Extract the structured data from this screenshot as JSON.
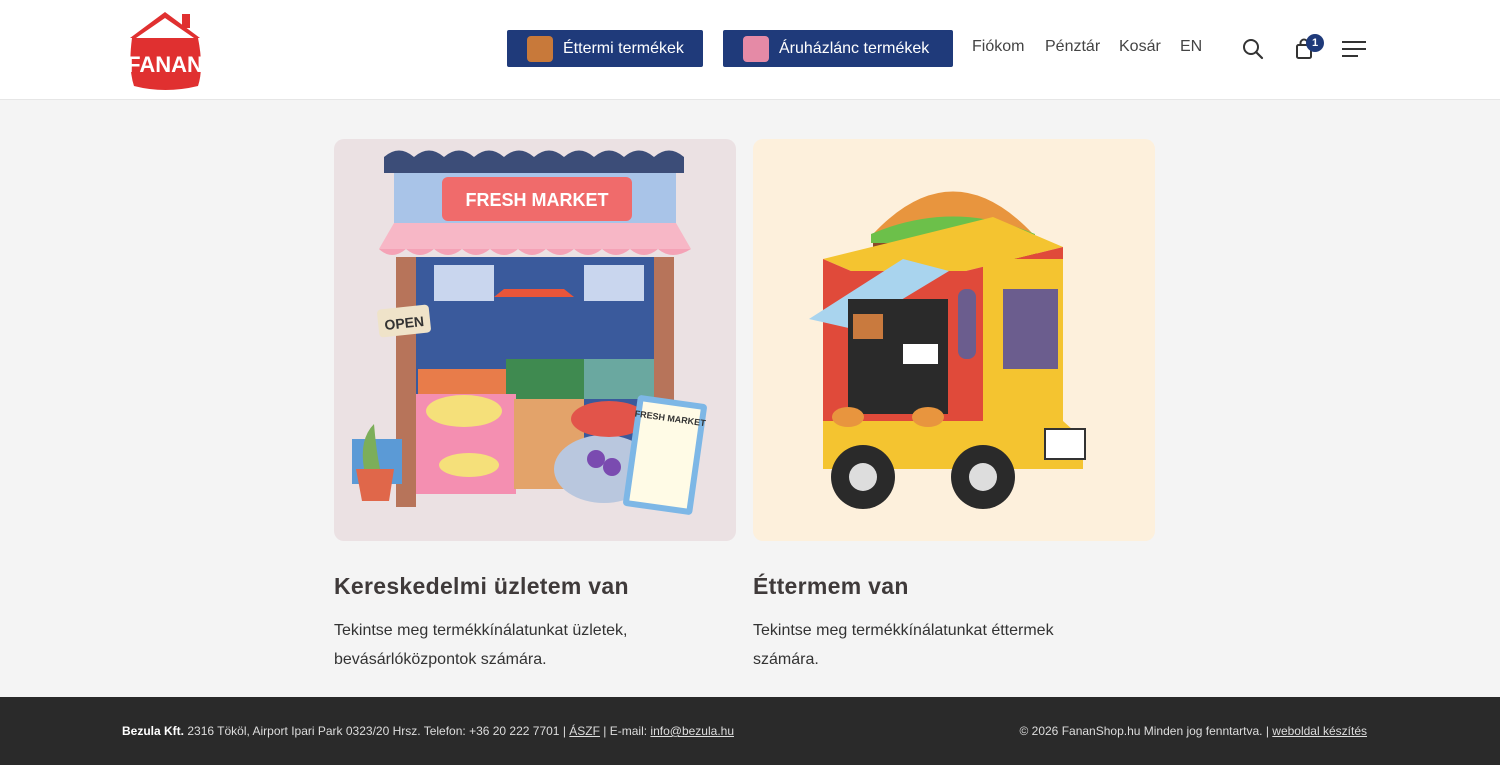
{
  "header": {
    "logo_text": "FANAN",
    "restaurant_button": "Éttermi termékek",
    "chain_button": "Áruházlánc termékek",
    "links": [
      "Fiókom",
      "Pénztár",
      "Kosár",
      "EN"
    ],
    "cart_count": "1",
    "icons": [
      "search-icon",
      "cart-icon",
      "menu-icon"
    ]
  },
  "cards": [
    {
      "image_text": "FRESH MARKET",
      "image_sign": "OPEN",
      "image_board": "FRESH MARKET",
      "title": "Kereskedelmi üzletem van",
      "description_line1": "Tekintse meg termékkínálatunkat üzletek,",
      "description_line2": "bevásárlóközpontok számára."
    },
    {
      "title": "Éttermem van",
      "description_line1": "Tekintse meg termékkínálatunkat éttermek",
      "description_line2": "számára."
    }
  ],
  "footer": {
    "company": "Bezula Kft.",
    "address": " 2316 Tököl, Airport Ipari Park 0323/20 Hrsz. Telefon: +36 20 222 7701 | ",
    "terms_link": "ÁSZF",
    "email_label": " | E-mail: ",
    "email": "info@bezula.hu",
    "copyright": "© 2026 FananShop.hu Minden jog fenntartva. | ",
    "webdesign_link": "weboldal készítés"
  },
  "colors": {
    "brand_red": "#e03030",
    "nav_blue": "#1f3a7a",
    "footer_bg": "#2a2a2a"
  }
}
